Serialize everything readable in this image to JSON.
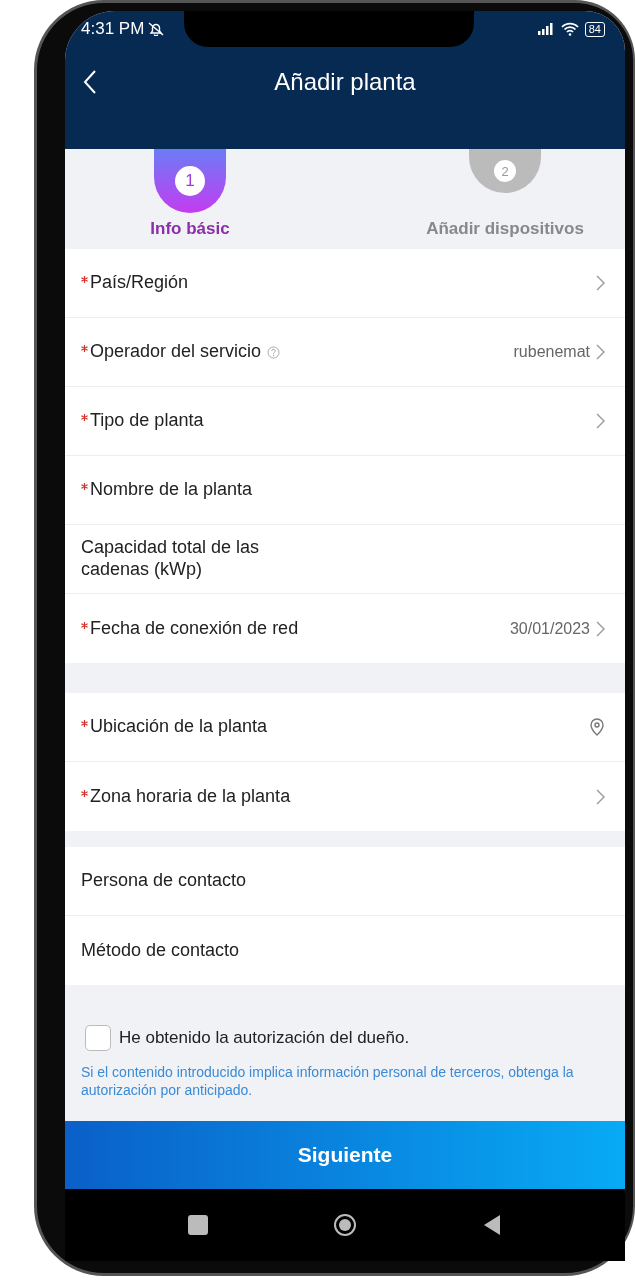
{
  "status_bar": {
    "time": "4:31 PM",
    "battery": "84"
  },
  "header": {
    "title": "Añadir planta"
  },
  "steps": [
    {
      "number": "1",
      "label": "Info básic",
      "selected": true
    },
    {
      "number": "2",
      "label": "Añadir dispositivos",
      "selected": false
    }
  ],
  "sections": [
    [
      {
        "label": "País/Región",
        "required": true,
        "help": false,
        "kind": "chevron"
      },
      {
        "label": "Operador del servicio",
        "required": true,
        "help": true,
        "kind": "chevron",
        "value": "rubenemat"
      },
      {
        "label": "Tipo de planta",
        "required": true,
        "help": false,
        "kind": "chevron"
      },
      {
        "label": "Nombre de la planta",
        "required": true,
        "help": false,
        "kind": "plain"
      },
      {
        "label": "Capacidad total de las cadenas (kWp)",
        "required": false,
        "help": false,
        "kind": "plain"
      },
      {
        "label": "Fecha de conexión de red",
        "required": true,
        "help": false,
        "kind": "chevron",
        "value": "30/01/2023"
      }
    ],
    [
      {
        "label": "Ubicación de la planta",
        "required": true,
        "help": false,
        "kind": "location"
      },
      {
        "label": "Zona horaria de la planta",
        "required": true,
        "help": false,
        "kind": "chevron"
      }
    ],
    [
      {
        "label": "Persona de contacto",
        "required": false,
        "help": false,
        "kind": "plain"
      },
      {
        "label": "Método de contacto",
        "required": false,
        "help": false,
        "kind": "plain"
      }
    ]
  ],
  "consent": {
    "label": "He obtenido la autorización del dueño.",
    "checked": false
  },
  "note": "Si el contenido introducido implica información personal de terceros, obtenga la autorización por anticipado.",
  "next_button": "Siguiente"
}
